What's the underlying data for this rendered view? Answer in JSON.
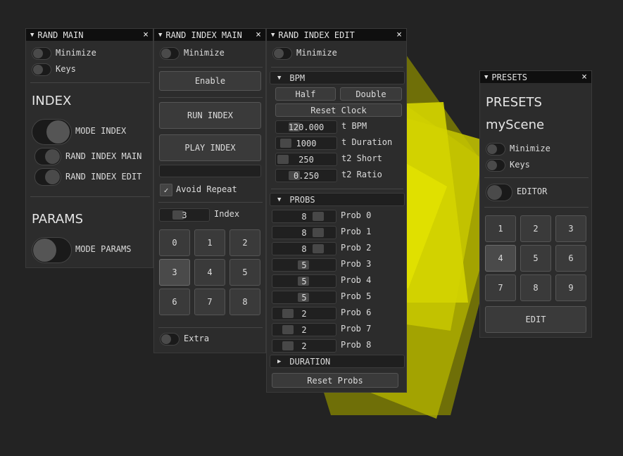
{
  "colors": {
    "background": "#232323",
    "panel": "#2c2c2c",
    "accent_yellow": "#dede00"
  },
  "rand_main": {
    "title": "RAND MAIN",
    "minimize": "Minimize",
    "keys": "Keys",
    "index_heading": "INDEX",
    "mode_index": "MODE INDEX",
    "rand_index_main": "RAND INDEX MAIN",
    "rand_index_edit": "RAND INDEX EDIT",
    "params_heading": "PARAMS",
    "mode_params": "MODE PARAMS"
  },
  "rand_index_main": {
    "title": "RAND INDEX MAIN",
    "minimize": "Minimize",
    "enable": "Enable",
    "run_index": "RUN INDEX",
    "play_index": "PLAY INDEX",
    "avoid_repeat": "Avoid Repeat",
    "index_value": "3",
    "index_label": "Index",
    "grid": [
      "0",
      "1",
      "2",
      "3",
      "4",
      "5",
      "6",
      "7",
      "8"
    ],
    "selected": "3",
    "extra": "Extra"
  },
  "rand_index_edit": {
    "title": "RAND INDEX EDIT",
    "minimize": "Minimize",
    "bpm_header": "BPM",
    "half": "Half",
    "double": "Double",
    "reset_clock": "Reset Clock",
    "params": [
      {
        "value": "120.000",
        "label": "t BPM"
      },
      {
        "value": "1000",
        "label": "t Duration"
      },
      {
        "value": "250",
        "label": "t2 Short"
      },
      {
        "value": "0.250",
        "label": "t2 Ratio"
      }
    ],
    "probs_header": "PROBS",
    "probs": [
      {
        "value": "8",
        "label": "Prob 0"
      },
      {
        "value": "8",
        "label": "Prob 1"
      },
      {
        "value": "8",
        "label": "Prob 2"
      },
      {
        "value": "5",
        "label": "Prob 3"
      },
      {
        "value": "5",
        "label": "Prob 4"
      },
      {
        "value": "5",
        "label": "Prob 5"
      },
      {
        "value": "2",
        "label": "Prob 6"
      },
      {
        "value": "2",
        "label": "Prob 7"
      },
      {
        "value": "2",
        "label": "Prob 8"
      }
    ],
    "duration_header": "DURATION",
    "reset_probs": "Reset Probs"
  },
  "presets": {
    "title": "PRESETS",
    "heading": "PRESETS",
    "scene": "myScene",
    "minimize": "Minimize",
    "keys": "Keys",
    "editor": "EDITOR",
    "grid": [
      "1",
      "2",
      "3",
      "4",
      "5",
      "6",
      "7",
      "8",
      "9"
    ],
    "selected": "4",
    "edit": "EDIT"
  }
}
